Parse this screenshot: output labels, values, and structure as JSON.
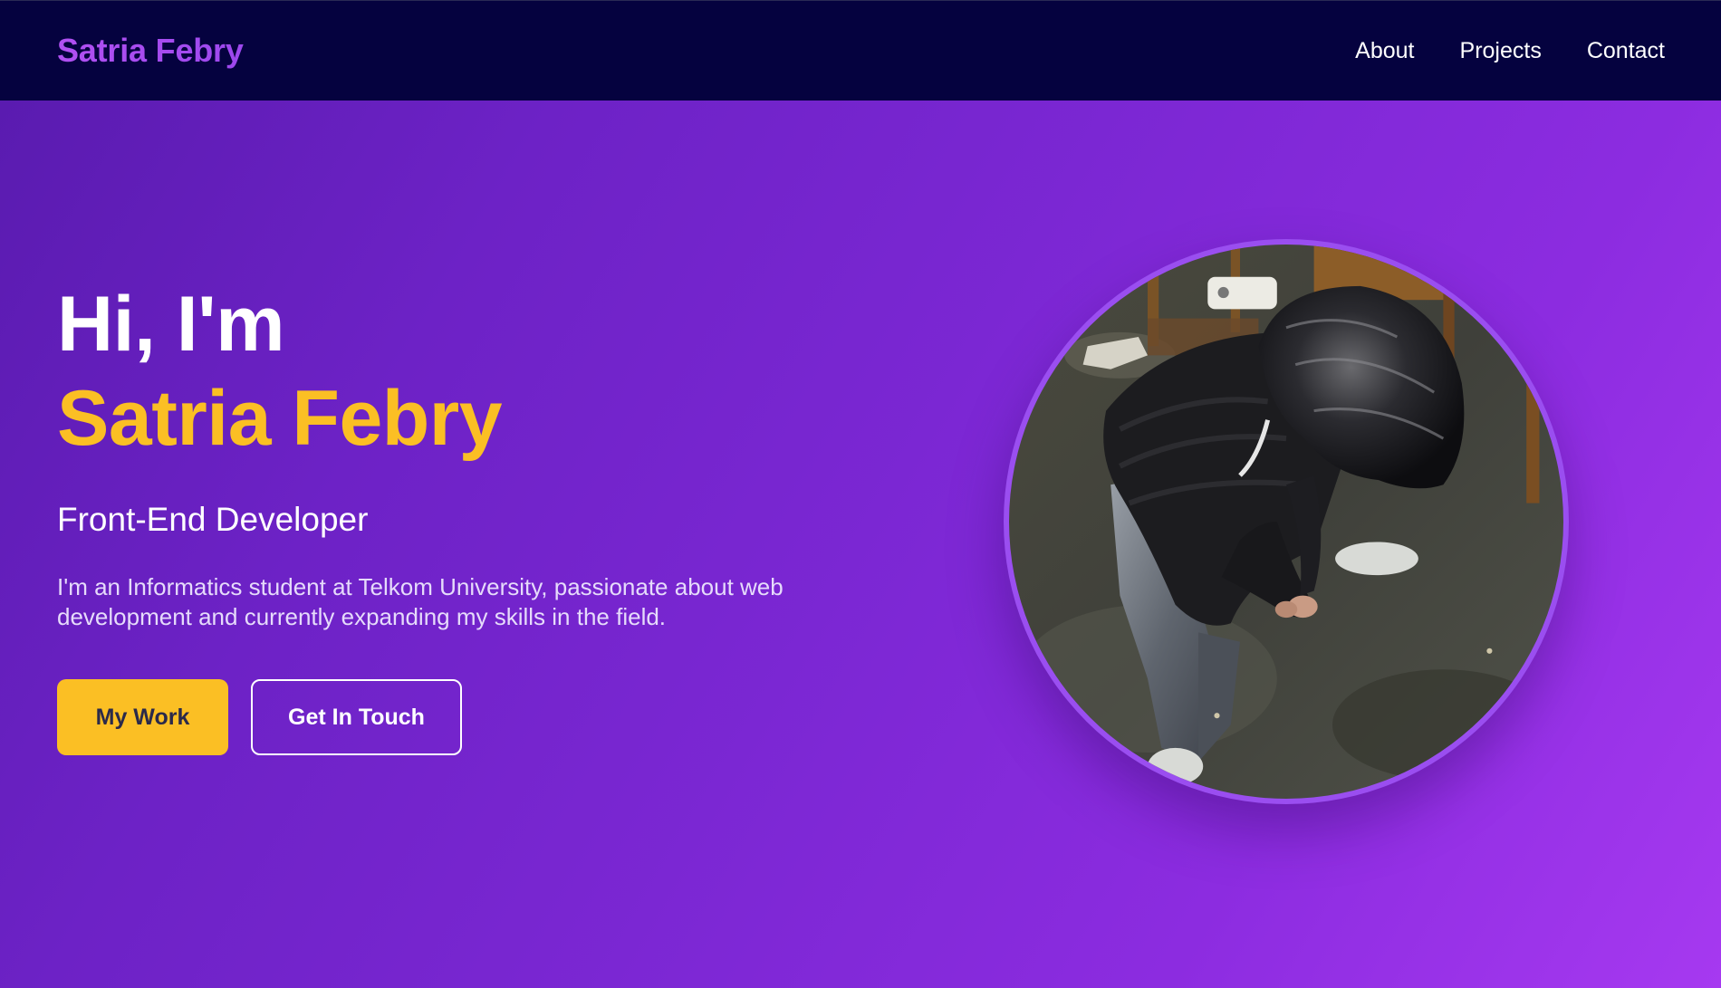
{
  "nav": {
    "logo": "Satria Febry",
    "links": [
      {
        "label": "About"
      },
      {
        "label": "Projects"
      },
      {
        "label": "Contact"
      }
    ]
  },
  "hero": {
    "greeting": "Hi, I'm",
    "name": "Satria Febry",
    "role": "Front-End Developer",
    "bio": "I'm an Informatics student at Telkom University, passionate about web development and currently expanding my skills in the field.",
    "primary_button": "My Work",
    "secondary_button": "Get In Touch"
  },
  "colors": {
    "nav_background": "#05023f",
    "logo": "#b150f2",
    "accent_yellow": "#fbbf24",
    "hero_gradient_start": "#5a1bb0",
    "hero_gradient_end": "#a639f0",
    "portrait_ring": "#9a4ef0"
  }
}
